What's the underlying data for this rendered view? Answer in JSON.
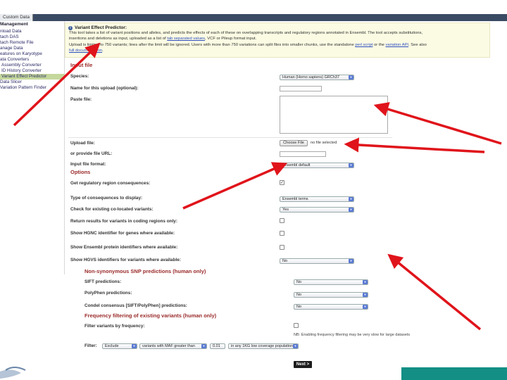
{
  "colors": {
    "accent": "#9a2a2a",
    "tab_bar": "#3a4a63",
    "active_sidebar": "#c5d89c",
    "info_bg": "#fbfbe4",
    "arrow": "#e0141b",
    "teal": "#138f86"
  },
  "tab": {
    "label": "Custom Data"
  },
  "sidebar": {
    "heading": "Management",
    "items": [
      {
        "label": "nload Data"
      },
      {
        "label": "tach DAS"
      },
      {
        "label": "tach Remote File"
      },
      {
        "label": "anage Data"
      },
      {
        "label": "eatures on Karyotype"
      },
      {
        "label": "ata Converters"
      },
      {
        "label": "Assembly Converter"
      },
      {
        "label": "ID History Converter"
      },
      {
        "label": "Variant Effect Predictor"
      },
      {
        "label": "Data Slicer"
      },
      {
        "label": "Variation Pattern Finder"
      }
    ]
  },
  "info": {
    "icon": "info-icon",
    "title": "Variant Effect Predictor:",
    "line1": "This tool takes a list of variant positions and alleles, and predicts the effects of each of these on overlapping transcripts and regulatory regions annotated in Ensembl. The tool accepts substitutions,",
    "line2a": "insertions and deletions as input, uploaded as a list of ",
    "line2_link": "tab separated values",
    "line2b": ", VCF or Pileup format input.",
    "line3a": "Upload is limited to 750 variants; lines after the limit will be ignored. Users with more than 750 variations can split files into smaller chunks, use the standalone ",
    "line3_link1": "perl script",
    "line3b": " or the ",
    "line3_link2": "variation API",
    "line3c": ". See also",
    "line4_link": "full documentation",
    "line4b": "."
  },
  "form": {
    "input_section": "Input file",
    "species_label": "Species:",
    "species_value": "Human (Homo sapiens) GRCh37",
    "name_label": "Name for this upload (optional):",
    "paste_label": "Paste file:",
    "upload_label": "Upload file:",
    "choose_file": "Choose File",
    "no_file": "no file selected",
    "url_label": "or provide file URL:",
    "format_label": "Input file format:",
    "format_value": "Ensembl default",
    "options_section": "Options",
    "regulatory_label": "Get regulatory region consequences:",
    "regulatory_checked": "✓",
    "consequence_label": "Type of consequences to display:",
    "consequence_value": "Ensembl terms",
    "colocated_label": "Check for existing co-located variants:",
    "colocated_value": "Yes",
    "coding_label": "Return results for variants in coding regions only:",
    "hgnc_label": "Show HGNC identifier for genes where available:",
    "protein_label": "Show Ensembl protein identifiers where available:",
    "hgvs_label": "Show HGVS identifiers for variants where available:",
    "hgvs_value": "No"
  },
  "form2": {
    "nonsyn_section": "Non-synonymous SNP predictions (human only)",
    "sift_label": "SIFT predictions:",
    "sift_value": "No",
    "polyphen_label": "PolyPhen predictions:",
    "polyphen_value": "No",
    "condel_label": "Condel consensus [SIFT/PolyPhen] predictions:",
    "condel_value": "No",
    "freq_section": "Frequency filtering of existing variants (human only)",
    "filter_freq_label": "Filter variants by frequency:",
    "nb_text": "NB: Enabling frequency filtering may be very slow for large datasets",
    "filter_label": "Filter:",
    "filter_action": "Exclude",
    "filter_what": "variants with MAF greater than",
    "filter_value": "0.01",
    "filter_pop": "in any 1KG low coverage population",
    "next_button": "Next >"
  }
}
